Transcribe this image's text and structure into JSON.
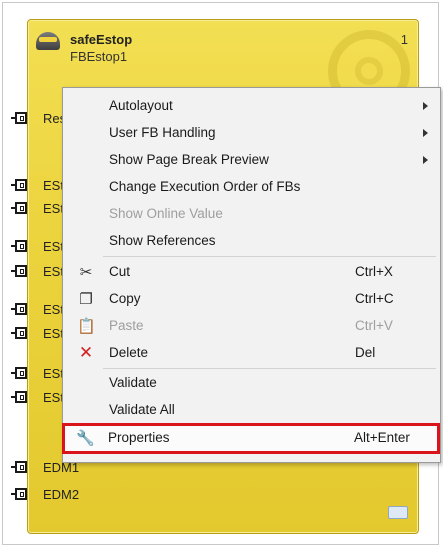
{
  "fb": {
    "title": "safeEstop",
    "instance": "FBEstop1",
    "number": "1",
    "ports": [
      {
        "label": "Res"
      },
      {
        "label": "ESto"
      },
      {
        "label": "ESto"
      },
      {
        "label": "ESto"
      },
      {
        "label": "ESto"
      },
      {
        "label": "ESto"
      },
      {
        "label": "ESto"
      },
      {
        "label": "ESto"
      },
      {
        "label": "ESto"
      },
      {
        "label": "EDM1"
      },
      {
        "label": "EDM2"
      }
    ]
  },
  "menu": {
    "items": [
      {
        "label": "Autolayout",
        "submenu": true
      },
      {
        "label": "User FB Handling",
        "submenu": true
      },
      {
        "label": "Show Page Break Preview",
        "submenu": true
      },
      {
        "label": "Change Execution Order of FBs"
      },
      {
        "label": "Show Online Value",
        "disabled": true
      },
      {
        "label": "Show References"
      },
      {
        "label": "Cut",
        "shortcut": "Ctrl+X",
        "icon": "cut-icon"
      },
      {
        "label": "Copy",
        "shortcut": "Ctrl+C",
        "icon": "copy-icon"
      },
      {
        "label": "Paste",
        "shortcut": "Ctrl+V",
        "icon": "paste-icon",
        "disabled": true
      },
      {
        "label": "Delete",
        "shortcut": "Del",
        "icon": "delete-icon"
      },
      {
        "label": "Validate"
      },
      {
        "label": "Validate All"
      },
      {
        "label": "Properties",
        "shortcut": "Alt+Enter",
        "icon": "wrench-icon",
        "highlighted": true
      }
    ]
  },
  "colors": {
    "fb_yellow": "#ecd43e",
    "highlight_red": "#d9151b",
    "delete_red": "#d42020"
  }
}
